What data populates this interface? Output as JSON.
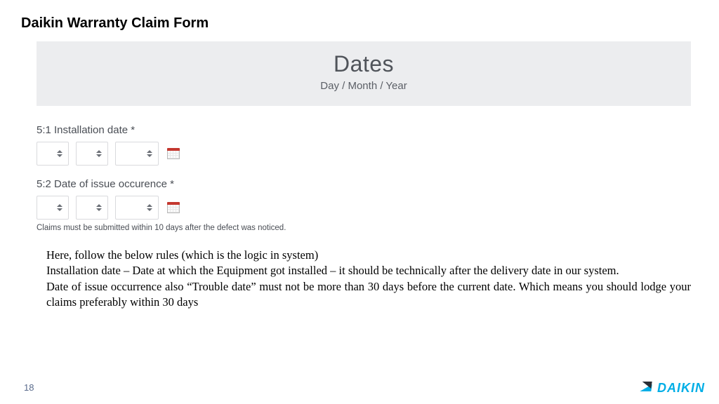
{
  "title": "Daikin Warranty Claim Form",
  "section": {
    "header": "Dates",
    "sub": "Day / Month / Year"
  },
  "fields": {
    "install": {
      "label": "5:1 Installation date *"
    },
    "issue": {
      "label": "5:2 Date of issue occurence *",
      "hint": "Claims must be submitted within 10 days after the defect was noticed."
    }
  },
  "rules": {
    "intro": "Here, follow the below rules (which is the logic in system)",
    "line1": "Installation date – Date at which the Equipment got installed – it should be technically after the delivery date in our system.",
    "line2": "Date of issue occurrence also “Trouble date”  must not be more than 30 days before the current date. Which means you should lodge your claims preferably within 30 days"
  },
  "pageNumber": "18",
  "brand": "DAIKIN"
}
